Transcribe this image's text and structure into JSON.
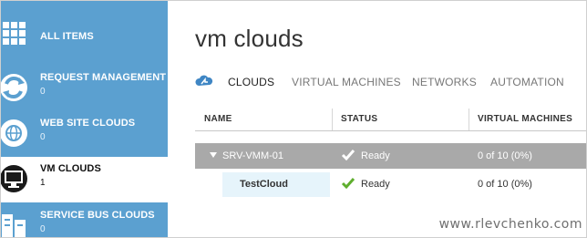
{
  "sidebar": {
    "items": [
      {
        "label": "ALL ITEMS",
        "count": "",
        "icon": "grid-icon"
      },
      {
        "label": "REQUEST MANAGEMENT",
        "count": "0",
        "icon": "recycle-arrows-icon"
      },
      {
        "label": "WEB SITE CLOUDS",
        "count": "0",
        "icon": "globe-icon"
      },
      {
        "label": "VM CLOUDS",
        "count": "1",
        "icon": "monitor-icon"
      },
      {
        "label": "SERVICE BUS CLOUDS",
        "count": "0",
        "icon": "service-bus-icon"
      }
    ],
    "active_index": 3,
    "colors": {
      "background": "#5ba0d0",
      "active": "#ffffff"
    }
  },
  "main": {
    "title": "vm clouds",
    "tabs": [
      {
        "label": "CLOUDS",
        "active": true
      },
      {
        "label": "VIRTUAL MACHINES",
        "active": false
      },
      {
        "label": "NETWORKS",
        "active": false
      },
      {
        "label": "AUTOMATION",
        "active": false
      }
    ],
    "table": {
      "columns": [
        "NAME",
        "STATUS",
        "VIRTUAL MACHINES"
      ],
      "rows": [
        {
          "name": "SRV-VMM-01",
          "status": "Ready",
          "vms": "0 of 10 (0%)",
          "type": "group"
        },
        {
          "name": "TestCloud",
          "status": "Ready",
          "vms": "0 of 10 (0%)",
          "type": "child"
        }
      ]
    }
  },
  "watermark": "www.rlevchenko.com"
}
